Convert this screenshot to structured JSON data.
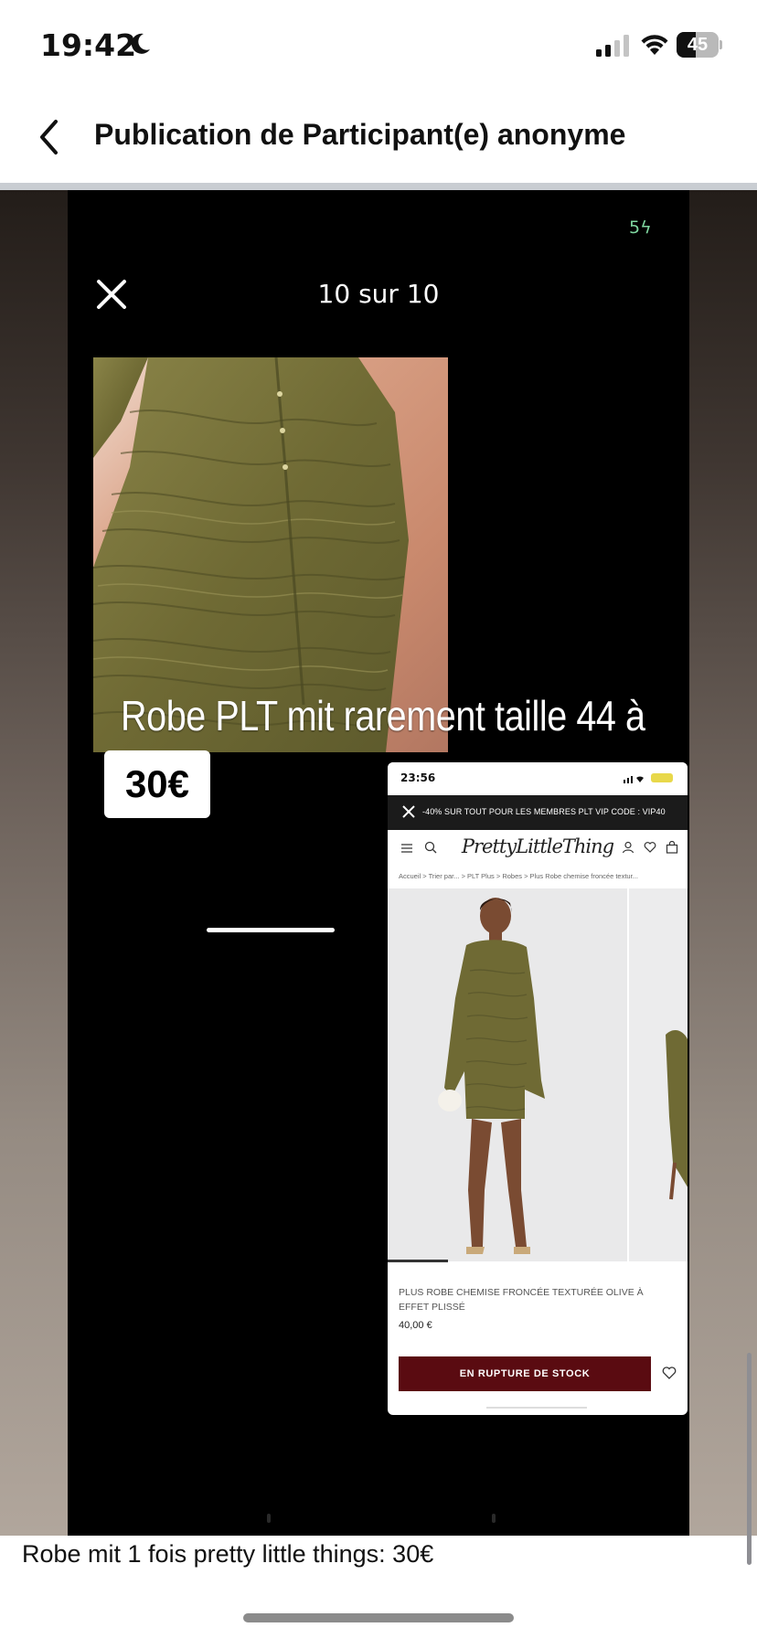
{
  "status_bar": {
    "time": "19:42",
    "battery_percent": "45",
    "battery_level": 0.45,
    "icons": [
      "moon-icon",
      "cellular-signal-icon",
      "wifi-icon",
      "battery-icon"
    ]
  },
  "header": {
    "title": "Publication de Participant(e) anonyme",
    "back_icon": "chevron-left-icon"
  },
  "story": {
    "battery_indicator": "5",
    "counter": "10 sur 10",
    "overlay_caption": "Robe PLT mit rarement  taille 44 à",
    "price_tag": "30€"
  },
  "embedded_screenshot": {
    "time": "23:56",
    "promo": "-40% SUR TOUT POUR LES MEMBRES PLT VIP CODE : VIP40",
    "logo": "PrettyLittleThing",
    "breadcrumbs": "Accueil  >  Trier par...  >  PLT Plus  >  Robes  >  Plus Robe chemise froncée textur...",
    "product_name": "PLUS ROBE CHEMISE FRONCÉE TEXTURÉE OLIVE À EFFET PLISSÉ",
    "product_price": "40,00 €",
    "out_of_stock_label": "EN RUPTURE DE STOCK"
  },
  "post": {
    "caption": "Robe mit 1 fois pretty little things: 30€"
  },
  "colors": {
    "out_of_stock_button": "#5a0b11",
    "story_background": "#000000",
    "dress_olive": "#6f6a34"
  }
}
